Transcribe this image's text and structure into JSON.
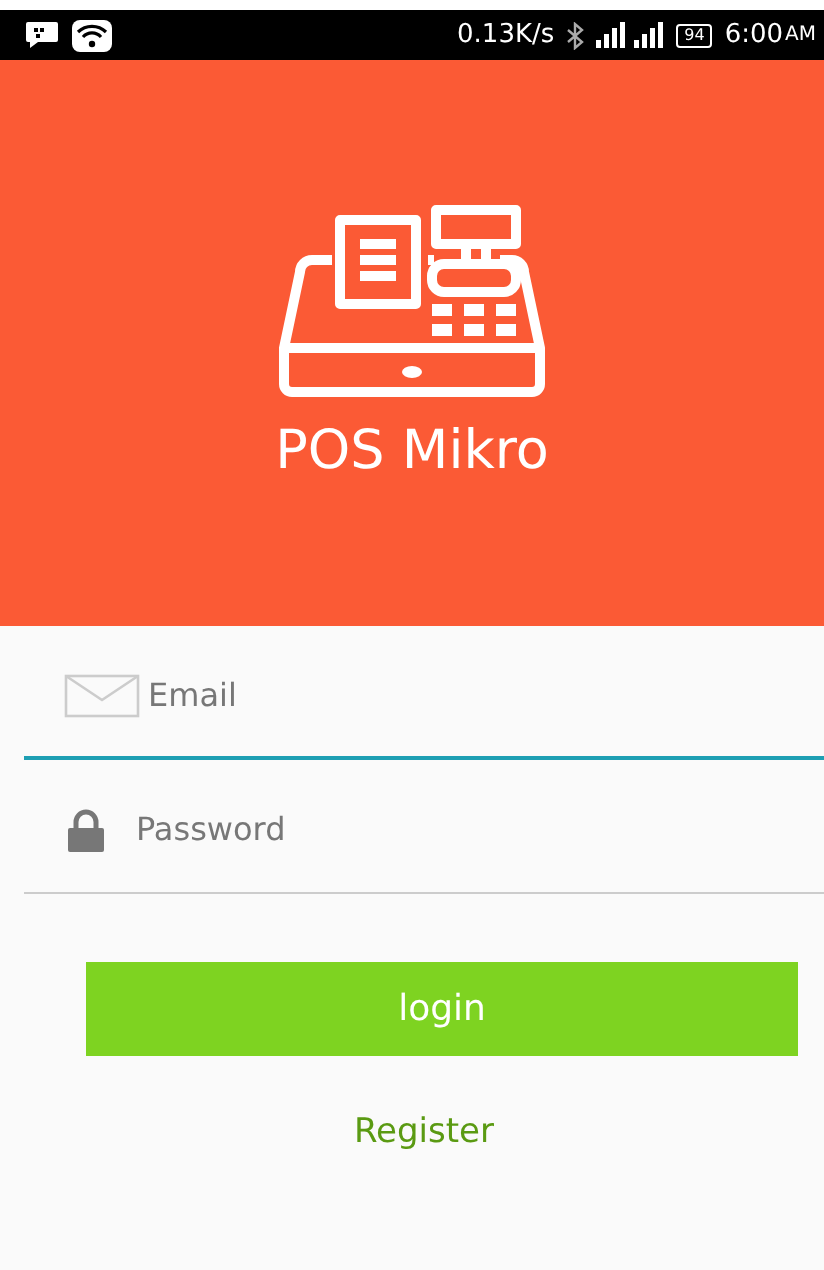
{
  "status_bar": {
    "network_speed": "0.13K/s",
    "battery": "94",
    "time": "6:00",
    "time_suffix": "AM"
  },
  "header": {
    "app_name": "POS Mikro"
  },
  "fields": [
    {
      "kind": "email",
      "placeholder": "Email",
      "focused": true
    },
    {
      "kind": "password",
      "placeholder": "Password",
      "focused": false
    }
  ],
  "login_button": "login",
  "register_link": "Register"
}
